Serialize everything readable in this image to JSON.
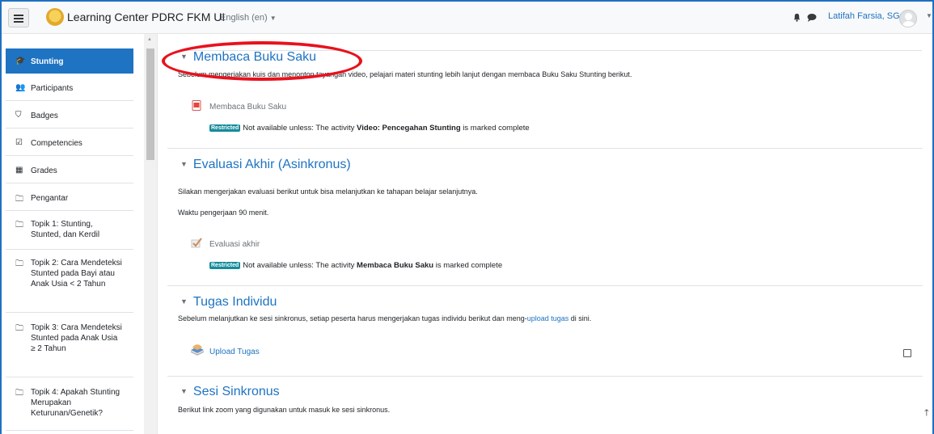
{
  "header": {
    "brand": "Learning Center PDRC FKM UI",
    "language": "English (en)",
    "user_name": "Latifah Farsia, SGz",
    "menu_icon": "hamburger-icon",
    "notification_icon": "bell-icon",
    "messages_icon": "chat-icon"
  },
  "sidebar": {
    "items": [
      {
        "label": "Stunting",
        "icon": "graduation-cap-icon",
        "active": true
      },
      {
        "label": "Participants",
        "icon": "users-icon"
      },
      {
        "label": "Badges",
        "icon": "shield-icon"
      },
      {
        "label": "Competencies",
        "icon": "checkbox-icon"
      },
      {
        "label": "Grades",
        "icon": "table-icon"
      },
      {
        "label": "Pengantar",
        "icon": "folder-icon"
      },
      {
        "label": "Topik 1: Stunting, Stunted, dan Kerdil",
        "icon": "folder-icon"
      },
      {
        "label": "Topik 2: Cara Mendeteksi Stunted pada Bayi atau Anak Usia < 2 Tahun",
        "icon": "folder-icon"
      },
      {
        "label": "Topik 3: Cara Mendeteksi Stunted pada Anak Usia ≥ 2 Tahun",
        "icon": "folder-icon"
      },
      {
        "label": "Topik 4: Apakah Stunting Merupakan Keturunan/Genetik?",
        "icon": "folder-icon"
      }
    ]
  },
  "sections": [
    {
      "title": "Membaca Buku Saku",
      "description": "Sebelum mengerjakan kuis dan menonton tayangan video, pelajari materi stunting lebih lanjut dengan membaca Buku Saku Stunting berikut.",
      "activity": "Membaca Buku Saku",
      "activity_icon": "pdf-icon",
      "restriction_badge": "Restricted",
      "restriction_before": "Not available unless: The activity ",
      "restriction_activity": "Video: Pencegahan Stunting",
      "restriction_after": " is marked complete"
    },
    {
      "title": "Evaluasi Akhir (Asinkronus)",
      "description": "Silakan mengerjakan evaluasi berikut untuk bisa melanjutkan ke tahapan belajar selanjutnya.",
      "description2": "Waktu pengerjaan 90 menit.",
      "activity": "Evaluasi akhir",
      "activity_icon": "quiz-check-icon",
      "restriction_badge": "Restricted",
      "restriction_before": "Not available unless: The activity ",
      "restriction_activity": "Membaca Buku Saku",
      "restriction_after": " is marked complete"
    },
    {
      "title": "Tugas Individu",
      "description_before": "Sebelum melanjutkan ke sesi sinkronus, setiap peserta harus mengerjakan tugas individu berikut dan meng-",
      "description_link": "upload tugas",
      "description_after": " di sini.",
      "activity": "Upload Tugas",
      "activity_icon": "assignment-icon"
    },
    {
      "title": "Sesi Sinkronus",
      "description": "Berikut link zoom yang digunakan untuk masuk ke sesi sinkronus."
    }
  ],
  "colors": {
    "brand_blue": "#1e73c2",
    "restricted_badge": "#168b9a",
    "annotation_red": "#e8121d"
  }
}
